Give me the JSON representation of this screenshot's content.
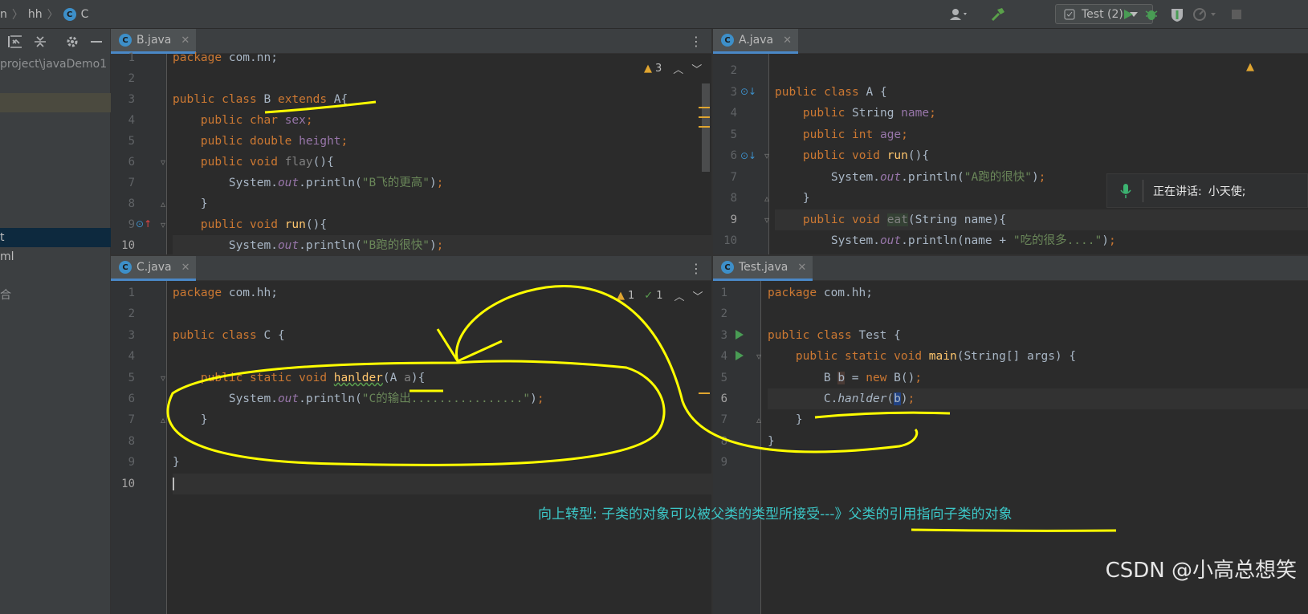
{
  "breadcrumbs": {
    "module_tail": "n",
    "package": "hh",
    "class_icon": "C",
    "class_name": "C"
  },
  "toolbar": {
    "run_config": "Test (2)",
    "icons": [
      "user-icon",
      "hammer-icon",
      "run-icon",
      "debug-icon",
      "coverage-icon",
      "profile-icon",
      "stop-icon"
    ]
  },
  "sidebar": {
    "project_path": "project\\javaDemo1",
    "rows": [
      {
        "text": "t",
        "selected": true
      },
      {
        "text": "ml",
        "selected": false
      },
      {
        "text": "合",
        "selected": false
      }
    ]
  },
  "panes": {
    "b": {
      "tab": "B.java",
      "icon": "C",
      "inspections": {
        "warnings": "3"
      },
      "lines": [
        {
          "n": "1",
          "html": "<span class=\"kw\">package</span> com.nn;"
        },
        {
          "n": "2",
          "html": ""
        },
        {
          "n": "3",
          "html": "<span class=\"kw\">public class</span> B <span class=\"kw\">extends</span> A{"
        },
        {
          "n": "4",
          "html": "    <span class=\"kw\">public char</span> <span class=\"fld\">sex</span><span class=\"kw\">;</span>"
        },
        {
          "n": "5",
          "html": "    <span class=\"kw\">public double</span> <span class=\"fld\">height</span><span class=\"kw\">;</span>"
        },
        {
          "n": "6",
          "html": "    <span class=\"kw\">public void</span> <span class=\"unu\">flay</span>(){"
        },
        {
          "n": "7",
          "html": "        System.<span class=\"fld ital\">out</span>.println(<span class=\"st\">\"B飞的更高\"</span>)<span class=\"kw\">;</span>"
        },
        {
          "n": "8",
          "html": "    }"
        },
        {
          "n": "9",
          "html": "    <span class=\"kw\">public void</span> <span class=\"fnm\">run</span>(){"
        },
        {
          "n": "10",
          "html": "        System.<span class=\"fld ital\">out</span>.println(<span class=\"st\">\"B跑的很快\"</span>)<span class=\"kw\">;</span>"
        }
      ]
    },
    "a": {
      "tab": "A.java",
      "icon": "C",
      "inspections": {
        "warnings": ""
      },
      "lines": [
        {
          "n": "2",
          "html": ""
        },
        {
          "n": "3",
          "html": "<span class=\"kw\">public class</span> A {"
        },
        {
          "n": "4",
          "html": "    <span class=\"kw\">public</span> String <span class=\"fld\">name</span><span class=\"kw\">;</span>"
        },
        {
          "n": "5",
          "html": "    <span class=\"kw\">public int</span> <span class=\"fld\">age</span><span class=\"kw\">;</span>"
        },
        {
          "n": "6",
          "html": "    <span class=\"kw\">public void</span> <span class=\"fnm\">run</span>(){"
        },
        {
          "n": "7",
          "html": "        System.<span class=\"fld ital\">out</span>.println(<span class=\"st\">\"A跑的很快\"</span>)<span class=\"kw\">;</span>"
        },
        {
          "n": "8",
          "html": "    }"
        },
        {
          "n": "9",
          "html": "    <span class=\"kw\">public void</span> <span class=\"unu\" style=\"background:#344134\">eat</span>(String name){"
        },
        {
          "n": "10",
          "html": "        System.<span class=\"fld ital\">out</span>.println(name + <span class=\"st\">\"吃的很多....\"</span>)<span class=\"kw\">;</span>"
        }
      ]
    },
    "c": {
      "tab": "C.java",
      "icon": "C",
      "inspections": {
        "warnings": "1",
        "typos": "1"
      },
      "lines": [
        {
          "n": "1",
          "html": "<span class=\"kw\">package</span> com.hh;"
        },
        {
          "n": "2",
          "html": ""
        },
        {
          "n": "3",
          "html": "<span class=\"kw\">public class</span> C {"
        },
        {
          "n": "4",
          "html": ""
        },
        {
          "n": "5",
          "html": "    <span class=\"kw\">public static void</span> <span class=\"fnm\" style=\"text-decoration:underline wavy #5a9f4f\">hanlder</span>(A <span class=\"unu\">a</span>){"
        },
        {
          "n": "6",
          "html": "        System.<span class=\"fld ital\">out</span>.println(<span class=\"st\">\"C的输出................\"</span>)<span class=\"kw\">;</span>"
        },
        {
          "n": "7",
          "html": "    }"
        },
        {
          "n": "8",
          "html": ""
        },
        {
          "n": "9",
          "html": "}"
        },
        {
          "n": "10",
          "html": "<span style=\"border-left:2px solid #bbbbbb\"></span>"
        }
      ]
    },
    "test": {
      "tab": "Test.java",
      "icon": "C",
      "lines": [
        {
          "n": "1",
          "html": "<span class=\"kw\">package</span> com.hh;"
        },
        {
          "n": "2",
          "html": ""
        },
        {
          "n": "3",
          "html": "<span class=\"kw\">public class</span> Test {"
        },
        {
          "n": "4",
          "html": "    <span class=\"kw\">public static void</span> <span class=\"fnm\">main</span>(String[] args) {"
        },
        {
          "n": "5",
          "html": "        B <span style=\"background:#4a3a35\">b</span> = <span class=\"kw\">new</span> B()<span class=\"kw\">;</span>"
        },
        {
          "n": "6",
          "html": "        C.<span class=\"ital\">hanlder</span>(<span style=\"background:#214283\">b</span>)<span class=\"kw\">;</span>"
        },
        {
          "n": "7",
          "html": "    }"
        },
        {
          "n": "8",
          "html": "}"
        },
        {
          "n": "9",
          "html": ""
        }
      ]
    }
  },
  "speech": {
    "label": "正在讲话:",
    "name": "小天使;"
  },
  "annotation": "向上转型:   子类的对象可以被父类的类型所接受---》父类的引用指向子类的对象",
  "watermark": "CSDN @小高总想笑",
  "colors": {
    "accent": "#4a88c7",
    "ink": "#ffff00",
    "annotation": "#3cc8c8"
  }
}
